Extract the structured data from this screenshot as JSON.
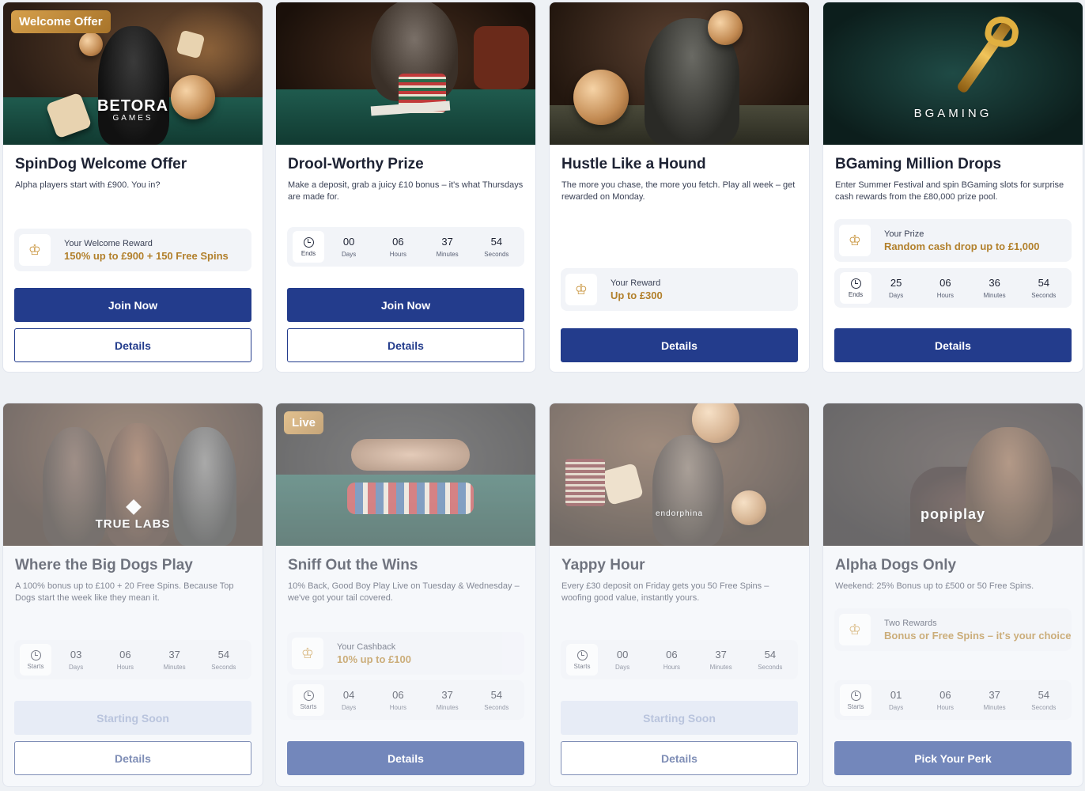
{
  "cards": [
    {
      "tag": "Welcome Offer",
      "brand": "BETORA",
      "brand_sub": "GAMES",
      "title": "SpinDog Welcome Offer",
      "desc": "Alpha players start with £900. You in?",
      "reward": {
        "label": "Your Welcome Reward",
        "value": "150% up to £900 + 150 Free Spins"
      },
      "primary": "Join Now",
      "secondary": "Details"
    },
    {
      "title": "Drool-Worthy Prize",
      "desc": "Make a deposit, grab a juicy £10 bonus – it's what Thursdays are made for.",
      "timer": {
        "label": "Ends",
        "days": "00",
        "hours": "06",
        "minutes": "37",
        "seconds": "54"
      },
      "primary": "Join Now",
      "secondary": "Details"
    },
    {
      "title": "Hustle Like a Hound",
      "desc": "The more you chase, the more you fetch. Play all week – get rewarded on Monday.",
      "reward": {
        "label": "Your Reward",
        "value": "Up to £300"
      },
      "primary": "Details"
    },
    {
      "brand": "BGAMING",
      "title": "BGaming Million Drops",
      "desc": "Enter Summer Festival and spin BGaming slots for surprise cash rewards from the £80,000 prize pool.",
      "reward": {
        "label": "Your Prize",
        "value": "Random cash drop up to £1,000"
      },
      "timer": {
        "label": "Ends",
        "days": "25",
        "hours": "06",
        "minutes": "36",
        "seconds": "54"
      },
      "primary": "Details"
    },
    {
      "brand": "TRUE LABS",
      "title": "Where the Big Dogs Play",
      "desc": "A 100% bonus up to £100 + 20 Free Spins. Because Top Dogs start the week like they mean it.",
      "timer": {
        "label": "Starts",
        "days": "03",
        "hours": "06",
        "minutes": "37",
        "seconds": "54"
      },
      "primary": "Starting Soon",
      "secondary": "Details"
    },
    {
      "tag": "Live",
      "title": "Sniff Out the Wins",
      "desc": "10% Back, Good Boy Play Live on Tuesday & Wednesday – we've got your tail covered.",
      "reward": {
        "label": "Your Cashback",
        "value": "10% up to £100"
      },
      "timer": {
        "label": "Starts",
        "days": "04",
        "hours": "06",
        "minutes": "37",
        "seconds": "54"
      },
      "primary": "Details"
    },
    {
      "brand": "endorphina",
      "title": "Yappy Hour",
      "desc": "Every £30 deposit on Friday gets you 50 Free Spins – woofing good value, instantly yours.",
      "timer": {
        "label": "Starts",
        "days": "00",
        "hours": "06",
        "minutes": "37",
        "seconds": "54"
      },
      "primary": "Starting Soon",
      "secondary": "Details"
    },
    {
      "brand": "popiplay",
      "title": "Alpha Dogs Only",
      "desc": "Weekend: 25% Bonus up to £500 or 50 Free Spins.",
      "reward": {
        "label": "Two Rewards",
        "value": "Bonus or Free Spins – it's your choice"
      },
      "timer": {
        "label": "Starts",
        "days": "01",
        "hours": "06",
        "minutes": "37",
        "seconds": "54"
      },
      "primary": "Pick Your Perk"
    }
  ],
  "units": {
    "days": "Days",
    "hours": "Hours",
    "minutes": "Minutes",
    "seconds": "Seconds"
  },
  "colors": {
    "primary": "#233c8c",
    "gold": "#b2802c",
    "page_bg": "#eef1f5"
  }
}
